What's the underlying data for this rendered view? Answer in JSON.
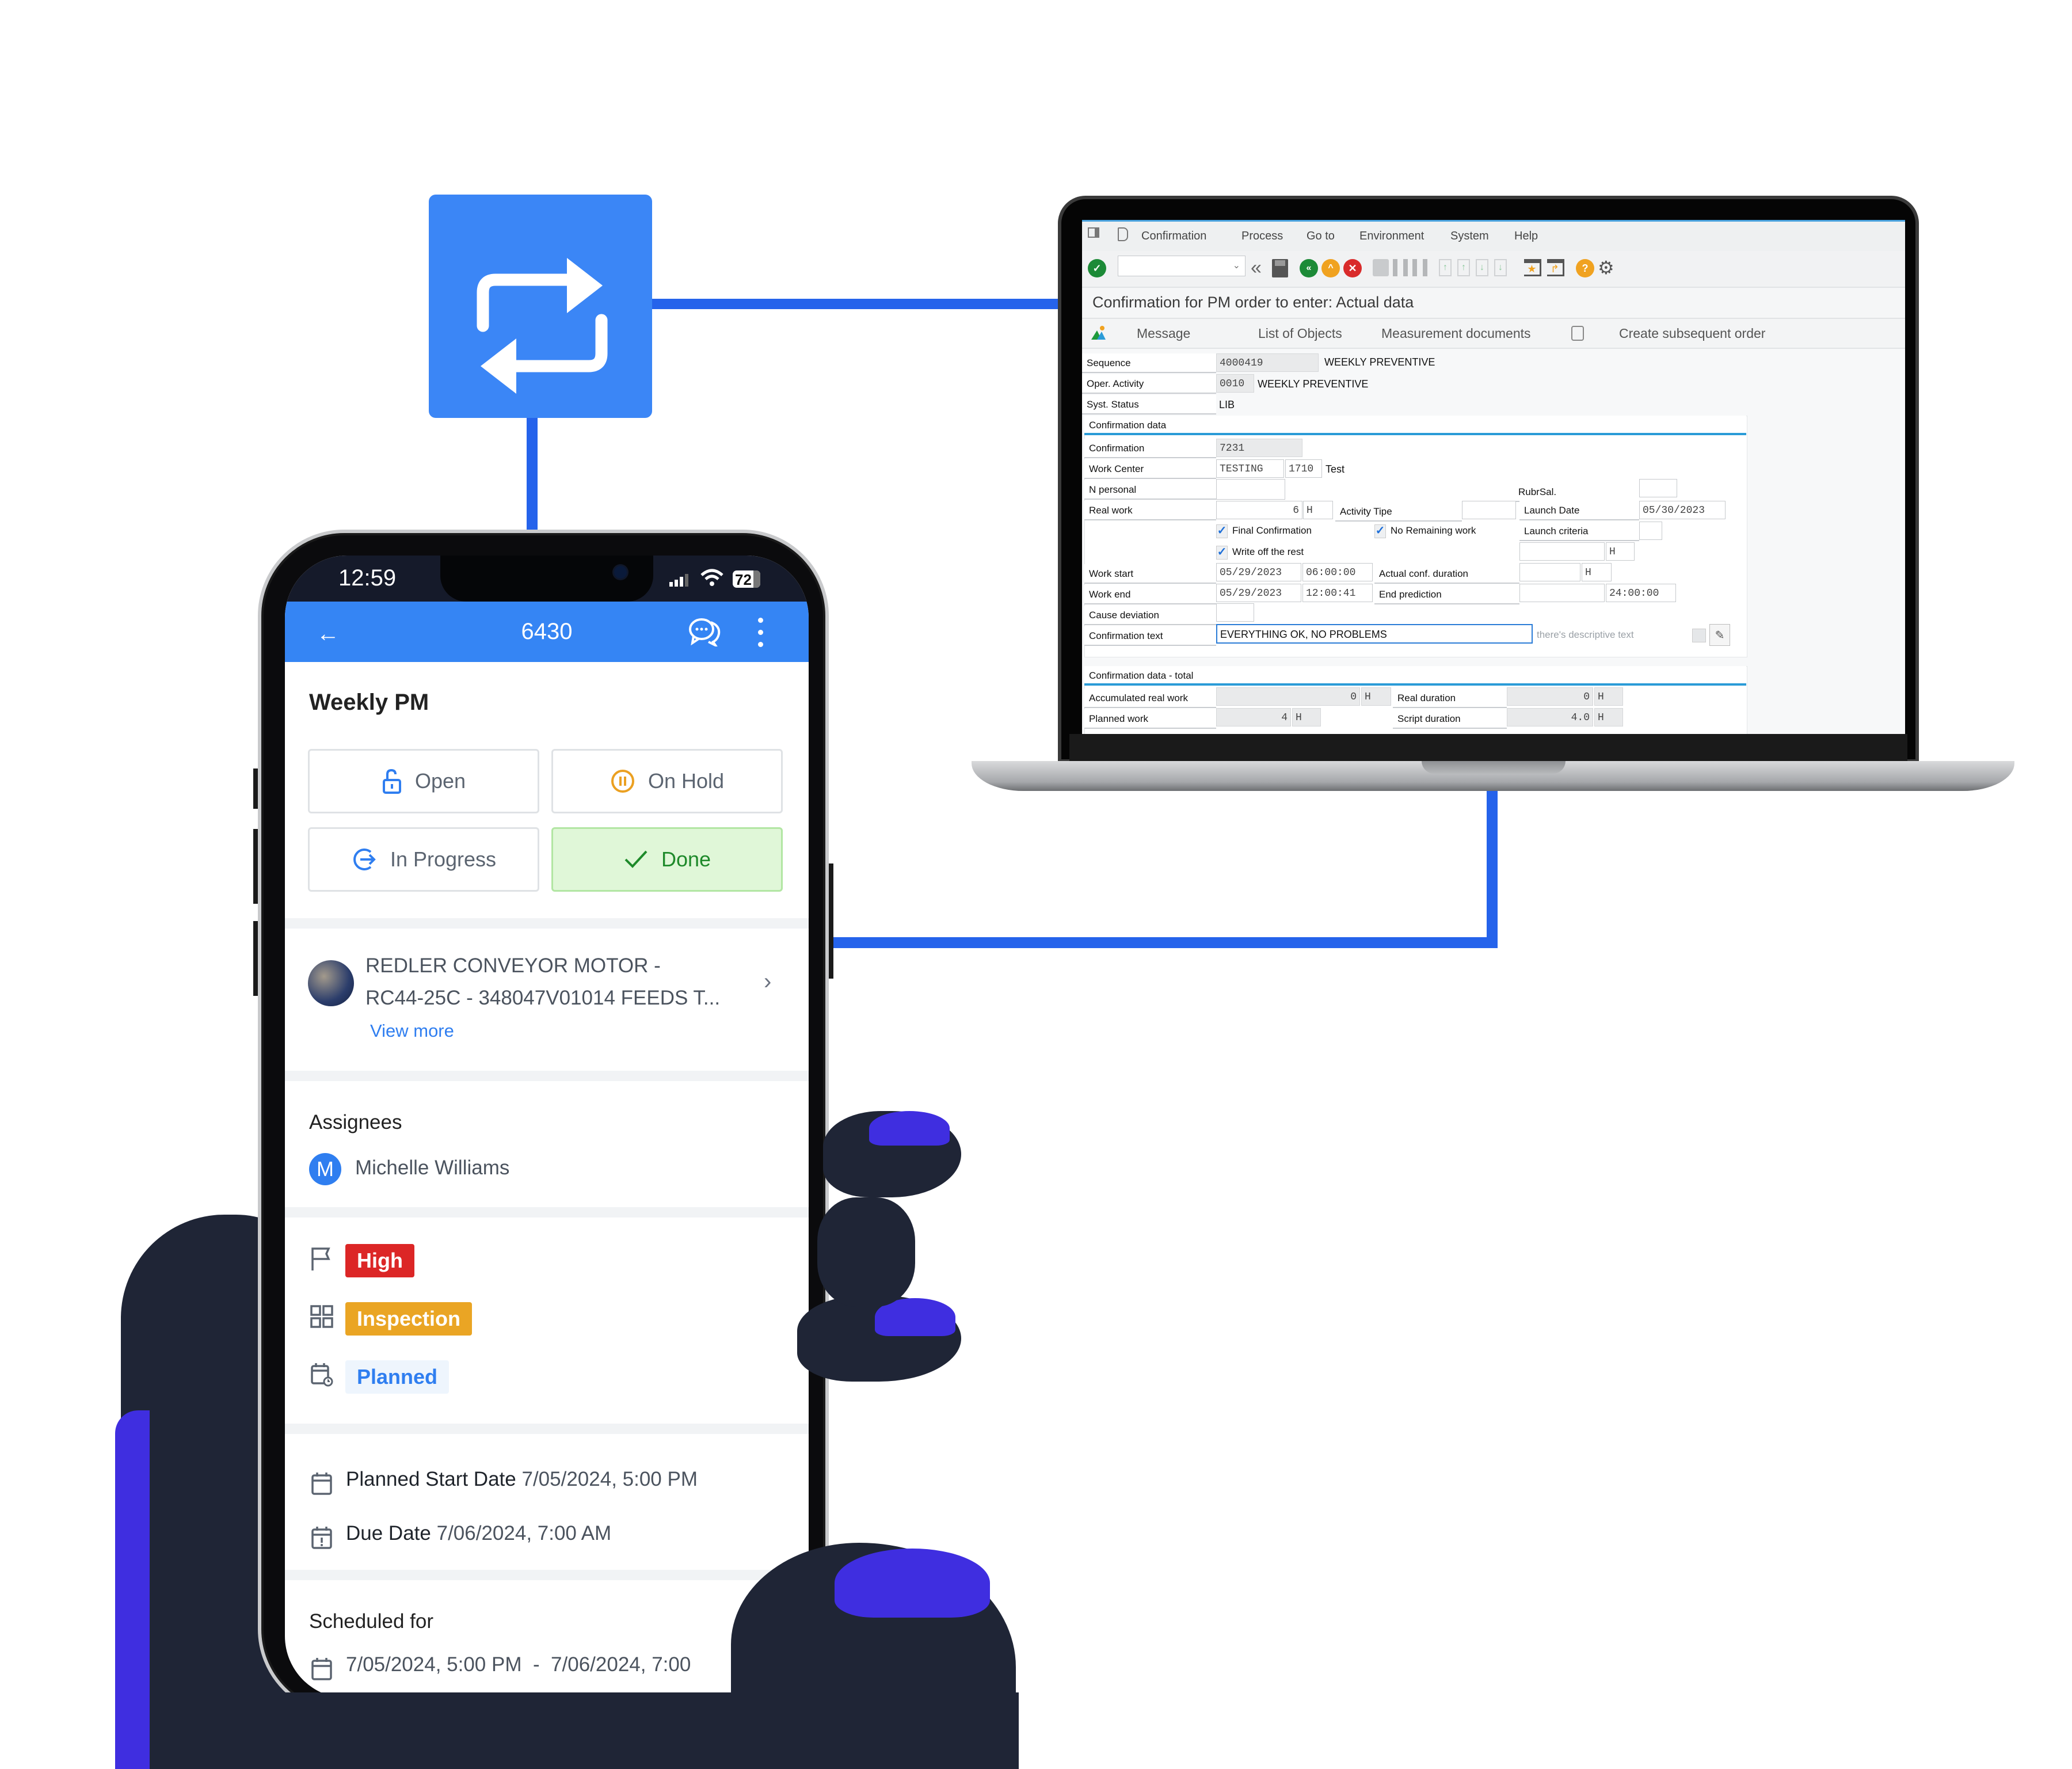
{
  "colors": {
    "connector": "#2563eb",
    "sync_box": "#3b86f6",
    "app_bar": "#3585f4",
    "priority_high": "#dc2626",
    "category_inspection": "#eaa524",
    "status_planned_bg": "#eef5fd",
    "status_planned_text": "#2f7ef0",
    "done_bg": "#e0f7d8",
    "done_text": "#1e8a2a"
  },
  "sync": {
    "icon": "repeat-arrows-icon"
  },
  "sap": {
    "menu": [
      "Confirmation",
      "Process",
      "Go to",
      "Environment",
      "System",
      "Help"
    ],
    "toolbar_icons": [
      "enter-check-icon",
      "command-field",
      "back-double-arrow-icon",
      "save-icon",
      "back-icon",
      "exit-icon",
      "cancel-icon",
      "print-icon",
      "find-icon",
      "find-next-icon",
      "first-page-icon",
      "previous-page-icon",
      "next-page-icon",
      "last-page-icon",
      "new-session-icon",
      "shortcut-icon",
      "help-icon",
      "settings-icon"
    ],
    "title": "Confirmation for PM order to enter: Actual data",
    "actions": {
      "message": "Message",
      "list_of_objects": "List of Objects",
      "measurement_documents": "Measurement documents",
      "create_subsequent_order": "Create subsequent order"
    },
    "header_fields": {
      "sequence_label": "Sequence",
      "sequence_value": "4000419",
      "sequence_text": "WEEKLY PREVENTIVE",
      "oper_label": "Oper. Activity",
      "oper_value": "0010",
      "oper_text": "WEEKLY PREVENTIVE",
      "status_label": "Syst. Status",
      "status_value": "LIB"
    },
    "confirmation_data": {
      "header": "Confirmation data",
      "confirmation_label": "Confirmation",
      "confirmation_value": "7231",
      "work_center_label": "Work Center",
      "work_center_value": "TESTING",
      "plant_value": "1710",
      "work_center_text": "Test",
      "n_personal_label": "N personal",
      "n_personal_value": "",
      "rubrsal_label": "RubrSal.",
      "rubrsal_value": "",
      "real_work_label": "Real work",
      "real_work_value": "6",
      "real_work_unit": "H",
      "activity_type_label": "Activity Tipe",
      "activity_type_value": "",
      "launch_date_label": "Launch Date",
      "launch_date_value": "05/30/2023",
      "final_confirmation_label": "Final Confirmation",
      "final_confirmation_checked": true,
      "no_remaining_label": "No Remaining work",
      "no_remaining_checked": true,
      "launch_criteria_label": "Launch criteria",
      "launch_criteria_value": "",
      "write_off_label": "Write off the rest",
      "write_off_checked": true,
      "remaining_unit": "H",
      "work_start_label": "Work start",
      "work_start_date": "05/29/2023",
      "work_start_time": "06:00:00",
      "actual_duration_label": "Actual conf. duration",
      "actual_duration_value": "",
      "actual_duration_unit": "H",
      "work_end_label": "Work end",
      "work_end_date": "05/29/2023",
      "work_end_time": "12:00:41",
      "end_prediction_label": "End prediction",
      "end_prediction_date": "",
      "end_prediction_time": "24:00:00",
      "cause_label": "Cause deviation",
      "cause_value": "",
      "conf_text_label": "Confirmation text",
      "conf_text_value": "EVERYTHING OK, NO PROBLEMS",
      "descriptive_hint": "there's descriptive text"
    },
    "totals": {
      "header": "Confirmation data - total",
      "accum_label": "Accumulated real work",
      "accum_value": "0",
      "accum_unit": "H",
      "real_duration_label": "Real duration",
      "real_duration_value": "0",
      "real_duration_unit": "H",
      "planned_label": "Planned work",
      "planned_value": "4",
      "planned_unit": "H",
      "script_label": "Script duration",
      "script_value": "4.0",
      "script_unit": "H"
    }
  },
  "phone": {
    "status_bar": {
      "time": "12:59",
      "battery": "72"
    },
    "app_bar": {
      "title": "6430"
    },
    "work_order": {
      "title": "Weekly PM",
      "statuses": [
        {
          "label": "Open",
          "icon": "unlock-icon",
          "active": false
        },
        {
          "label": "On Hold",
          "icon": "pause-circle-icon",
          "active": false
        },
        {
          "label": "In Progress",
          "icon": "in-progress-icon",
          "active": false
        },
        {
          "label": "Done",
          "icon": "check-icon",
          "active": true
        }
      ],
      "asset": {
        "line1": "REDLER CONVEYOR MOTOR -",
        "line2": "RC44-25C - 348047V01014 FEEDS T...",
        "view_more": "View more"
      },
      "assignees_label": "Assignees",
      "assignee": {
        "initial": "M",
        "name": "Michelle Williams"
      },
      "priority": "High",
      "category": "Inspection",
      "schedule_status": "Planned",
      "planned_start_label": "Planned Start Date",
      "planned_start_value": "7/05/2024, 5:00 PM",
      "due_label": "Due Date",
      "due_value": "7/06/2024, 7:00 AM",
      "scheduled_label": "Scheduled for",
      "scheduled_value": "7/05/2024, 5:00 PM  -  7/06/2024, 7:00"
    }
  }
}
